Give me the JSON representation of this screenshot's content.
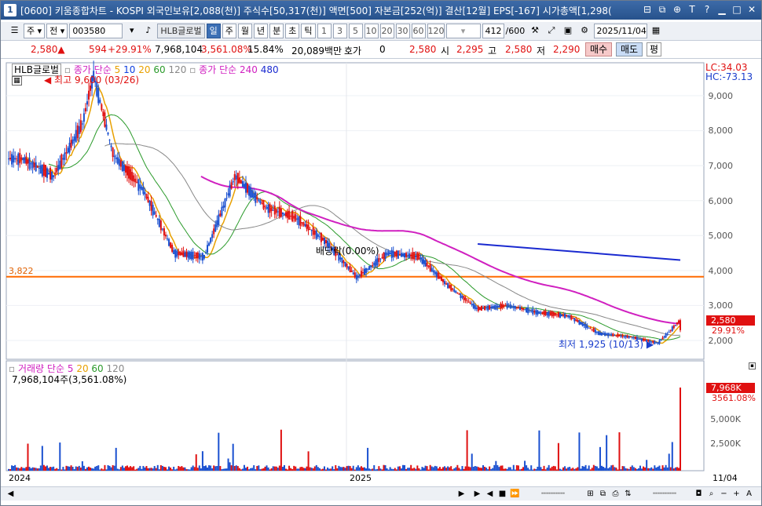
{
  "title": {
    "num": "1",
    "text": "[0600] 키움종합차트 - KOSPI 외국인보유[2,088(천)] 주식수[50,317(천)] 액면[500] 자본금[252(억)] 결산[12월] EPS[-167] 시가총액[1,298("
  },
  "toolbar": {
    "market": "주",
    "all": "전",
    "code": "003580",
    "stock_name": "HLB글로벌",
    "periods": [
      "일",
      "주",
      "월",
      "년",
      "분",
      "초",
      "틱"
    ],
    "intervals": [
      "1",
      "3",
      "5",
      "10",
      "20",
      "30",
      "60",
      "120"
    ],
    "count": "412",
    "max_count": "/600",
    "date": "2025/11/04"
  },
  "pricebar": {
    "price": "2,580",
    "change": "594",
    "change_pct": "+29.91%",
    "volume": "7,968,104",
    "volume_pct": "3,561.08%",
    "turnover": "15.84%",
    "amount": "20,089백만",
    "hoga_label": "호가",
    "hoga_value": "0",
    "price2": "2,580",
    "open_label": "시",
    "open": "2,295",
    "high_label": "고",
    "high": "2,580",
    "low_label": "저",
    "low": "2,290",
    "buy": "매수",
    "sell": "매도",
    "flat": "평"
  },
  "chart": {
    "legend_name": "HLB글로벌",
    "legend_ma_label": "종가 단순",
    "legend_ma": [
      "5",
      "10",
      "20",
      "60",
      "120"
    ],
    "legend_ma2_label": "종가 단순",
    "legend_ma2": [
      "240",
      "480"
    ],
    "high_note": "최고 9,600 (03/26)",
    "low_note": "최저 1,925 (10/13)",
    "dividend_note": "배당락(0.00%)",
    "hline_value": "3,822",
    "lc": "LC:34.03",
    "hc": "HC:-73.13",
    "price_tag": "2,580",
    "pct_tag": "29.91%",
    "y_ticks": [
      "9,000",
      "8,000",
      "7,000",
      "6,000",
      "5,000",
      "4,000",
      "3,000",
      "2,000"
    ],
    "vol_legend_label": "거래량",
    "vol_ma_label": "단순",
    "vol_ma": [
      "5",
      "20",
      "60",
      "120"
    ],
    "vol_value": "7,968,104주(3,561.08%)",
    "vol_tag": "7,968K",
    "vol_pct_tag": "3561.08%",
    "vol_ticks": [
      "5,000K",
      "2,500K"
    ],
    "x_labels": [
      "2024",
      "2025",
      "11/04"
    ],
    "colors": {
      "ma5": "#e8a000",
      "ma10": "#1040e0",
      "ma20": "#e8a000",
      "ma60": "#2a9a2a",
      "ma120": "#888888",
      "ma240": "#d020c0",
      "ma480": "#1a2ad0",
      "hline": "#ff6a00",
      "up": "#e01010",
      "down": "#1a50d0"
    }
  },
  "chart_data": {
    "type": "candlestick",
    "x_range": [
      "2024-01",
      "2025-11-04"
    ],
    "ylim": [
      1800,
      9700
    ],
    "price_points": [
      [
        "2024-01",
        7200
      ],
      [
        "2024-02",
        6700
      ],
      [
        "2024-03",
        8200
      ],
      [
        "2024-03-26",
        9600
      ],
      [
        "2024-04",
        7300
      ],
      [
        "2024-05",
        6300
      ],
      [
        "2024-06",
        4500
      ],
      [
        "2024-07",
        4400
      ],
      [
        "2024-08",
        6700
      ],
      [
        "2024-09",
        5800
      ],
      [
        "2024-10",
        5500
      ],
      [
        "2024-11",
        4800
      ],
      [
        "2024-12",
        3800
      ],
      [
        "2025-01",
        4500
      ],
      [
        "2025-02",
        4400
      ],
      [
        "2025-03",
        3600
      ],
      [
        "2025-04",
        2900
      ],
      [
        "2025-05",
        3000
      ],
      [
        "2025-06",
        2800
      ],
      [
        "2025-07",
        2700
      ],
      [
        "2025-08",
        2200
      ],
      [
        "2025-09",
        2100
      ],
      [
        "2025-10-13",
        1925
      ],
      [
        "2025-11-04",
        2580
      ]
    ],
    "hline": 3822,
    "volume_max_k": 7968
  }
}
